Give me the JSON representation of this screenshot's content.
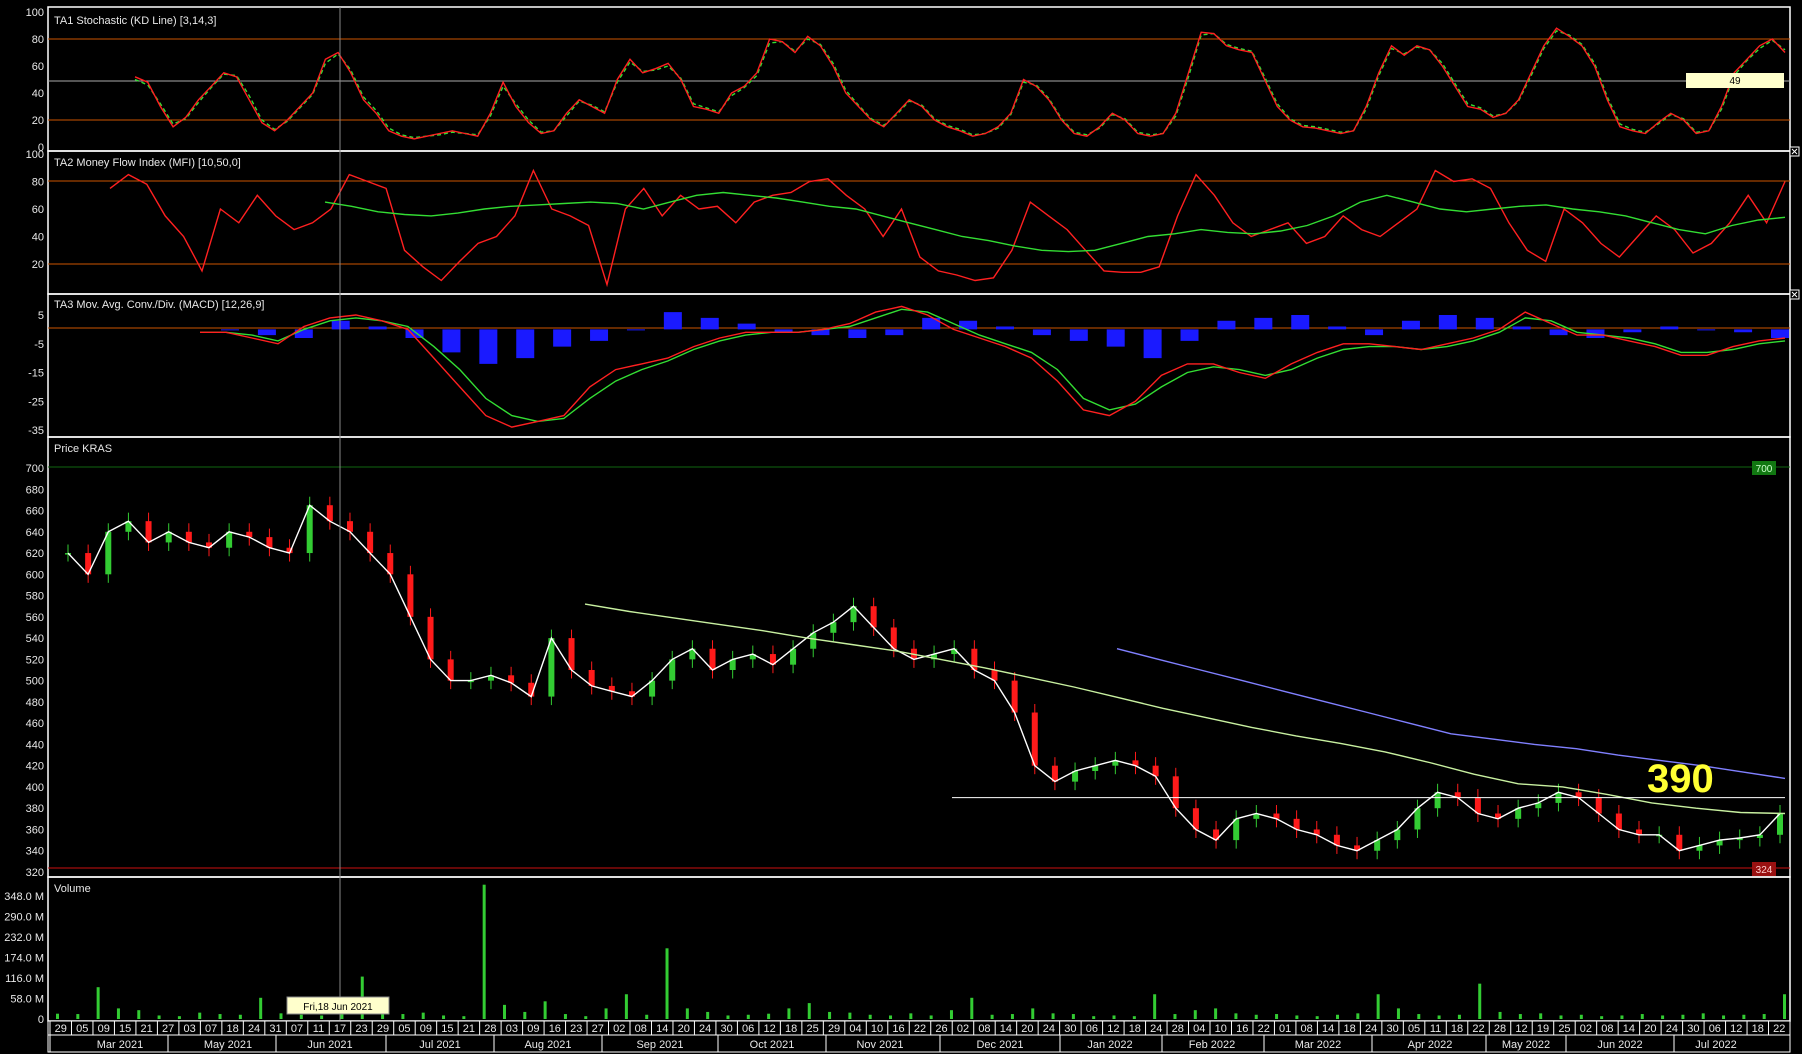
{
  "panels": {
    "stoch": {
      "title": "TA1 Stochastic (KD Line) [3,14,3]",
      "ticks": [
        "100",
        "80",
        "60",
        "40",
        "20",
        "0"
      ],
      "value_tag": "49"
    },
    "mfi": {
      "title": "TA2 Money Flow Index (MFI) [10,50,0]",
      "ticks": [
        "100",
        "80",
        "60",
        "40",
        "20"
      ]
    },
    "macd": {
      "title": "TA3 Mov. Avg. Conv./Div. (MACD) [12,26,9]",
      "ticks": [
        "5",
        "-5",
        "-15",
        "-25",
        "-35"
      ]
    },
    "price": {
      "title": "Price KRAS",
      "ticks": [
        "700",
        "680",
        "660",
        "640",
        "620",
        "600",
        "580",
        "560",
        "540",
        "520",
        "500",
        "480",
        "460",
        "440",
        "420",
        "400",
        "380",
        "360",
        "340",
        "320"
      ],
      "high_tag": "700",
      "low_tag": "324",
      "annotation": "390"
    },
    "volume": {
      "title": "Volume",
      "ticks": [
        "348.0 M",
        "290.0 M",
        "232.0 M",
        "174.0 M",
        "116.0 M",
        "58.0 M",
        "0"
      ],
      "cursor_tag": "Fri,18 Jun 2021"
    }
  },
  "date_axis": {
    "days": [
      "29",
      "05",
      "09",
      "15",
      "21",
      "27",
      "03",
      "07",
      "18",
      "24",
      "31",
      "07",
      "11",
      "17",
      "23",
      "29",
      "05",
      "09",
      "15",
      "21",
      "28",
      "03",
      "09",
      "16",
      "23",
      "27",
      "02",
      "08",
      "14",
      "20",
      "24",
      "30",
      "06",
      "12",
      "18",
      "25",
      "29",
      "04",
      "10",
      "16",
      "22",
      "26",
      "02",
      "08",
      "14",
      "20",
      "24",
      "30",
      "06",
      "12",
      "18",
      "24",
      "28",
      "04",
      "10",
      "16",
      "22",
      "01",
      "08",
      "14",
      "18",
      "24",
      "30",
      "05",
      "11",
      "18",
      "22",
      "28",
      "12",
      "19",
      "25",
      "02",
      "08",
      "14",
      "20",
      "24",
      "30",
      "06",
      "12",
      "18",
      "22"
    ],
    "months": [
      "Mar 2021",
      "May 2021",
      "Jun 2021",
      "Jul 2021",
      "Aug 2021",
      "Sep 2021",
      "Oct 2021",
      "Nov 2021",
      "Dec 2021",
      "Jan 2022",
      "Feb 2022",
      "Mar 2022",
      "Apr 2022",
      "May 2022",
      "Jun 2022",
      "Jul 2022"
    ]
  },
  "colors": {
    "up": "#33cc33",
    "down": "#ff1a1a",
    "k_line": "#ff2020",
    "d_line": "#33dd33",
    "mfi_line": "#ff2020",
    "mfi_ma": "#33dd33",
    "hist": "#1a1aff",
    "ma_short": "#ffffff",
    "ma_mid": "#c8f0a0",
    "ma_long": "#8080ff",
    "level": "#cc5500"
  },
  "chart_data": [
    {
      "type": "line",
      "title": "TA1 Stochastic (KD Line) [3,14,3]",
      "ylim": [
        0,
        100
      ],
      "series": [
        {
          "values": [
            52,
            48,
            30,
            15,
            22,
            35,
            45,
            55,
            52,
            35,
            18,
            12,
            20,
            30,
            40,
            65,
            70,
            55,
            35,
            25,
            12,
            8,
            6,
            8,
            10,
            12,
            10,
            8,
            25,
            48,
            30,
            18,
            10,
            12,
            25,
            35,
            30,
            25,
            50,
            65,
            55,
            58,
            62,
            50,
            30,
            28,
            25,
            40,
            45,
            55,
            80,
            78,
            70,
            82,
            75,
            60,
            40,
            30,
            20,
            15,
            25,
            35,
            30,
            20,
            15,
            12,
            8,
            10,
            15,
            25,
            50,
            45,
            35,
            20,
            10,
            8,
            15,
            25,
            20,
            10,
            8,
            10,
            25,
            55,
            85,
            84,
            75,
            72,
            70,
            50,
            30,
            20,
            15,
            14,
            12,
            10,
            12,
            30,
            55,
            75,
            68,
            75,
            72,
            60,
            45,
            30,
            28,
            22,
            25,
            35,
            55,
            75,
            88,
            82,
            75,
            60,
            35,
            15,
            12,
            10,
            18,
            25,
            20,
            10,
            12,
            30,
            55,
            65,
            75,
            80,
            70
          ]
        },
        {
          "values": [
            50,
            46,
            32,
            17,
            21,
            33,
            44,
            54,
            53,
            38,
            20,
            13,
            19,
            29,
            39,
            62,
            69,
            57,
            37,
            27,
            14,
            9,
            7,
            8,
            9,
            11,
            10,
            9,
            23,
            45,
            32,
            20,
            11,
            12,
            23,
            34,
            31,
            26,
            48,
            63,
            56,
            57,
            60,
            51,
            32,
            29,
            26,
            38,
            44,
            53,
            77,
            78,
            71,
            80,
            76,
            62,
            42,
            31,
            21,
            16,
            24,
            34,
            31,
            21,
            16,
            13,
            9,
            10,
            14,
            24,
            48,
            46,
            36,
            21,
            11,
            9,
            14,
            24,
            21,
            11,
            9,
            10,
            23,
            52,
            83,
            84,
            76,
            73,
            71,
            52,
            32,
            21,
            16,
            15,
            13,
            11,
            12,
            28,
            53,
            73,
            69,
            74,
            72,
            62,
            47,
            32,
            29,
            23,
            25,
            34,
            53,
            73,
            86,
            83,
            76,
            62,
            37,
            17,
            13,
            11,
            17,
            24,
            21,
            11,
            12,
            28,
            53,
            64,
            73,
            79,
            72
          ]
        }
      ]
    },
    {
      "type": "line",
      "title": "TA2 Money Flow Index (MFI) [10,50,0]",
      "ylim": [
        0,
        100
      ],
      "series": [
        {
          "values": [
            75,
            85,
            78,
            55,
            40,
            15,
            60,
            50,
            70,
            55,
            45,
            50,
            60,
            85,
            80,
            75,
            30,
            18,
            8,
            22,
            35,
            40,
            55,
            88,
            60,
            55,
            48,
            5,
            60,
            75,
            55,
            70,
            60,
            62,
            50,
            65,
            70,
            72,
            80,
            82,
            70,
            60,
            40,
            60,
            25,
            15,
            12,
            8,
            10,
            30,
            65,
            55,
            45,
            30,
            15,
            14,
            14,
            18,
            55,
            85,
            70,
            50,
            40,
            45,
            50,
            35,
            40,
            55,
            45,
            40,
            50,
            60,
            88,
            80,
            82,
            75,
            50,
            30,
            22,
            60,
            50,
            35,
            25,
            40,
            55,
            45,
            28,
            35,
            50,
            70,
            50,
            80
          ]
        },
        {
          "values": [
            65,
            62,
            58,
            56,
            55,
            57,
            60,
            62,
            63,
            64,
            65,
            64,
            60,
            65,
            70,
            72,
            70,
            68,
            65,
            62,
            60,
            55,
            50,
            45,
            40,
            37,
            33,
            30,
            29,
            30,
            35,
            40,
            42,
            45,
            43,
            42,
            44,
            48,
            55,
            65,
            70,
            65,
            60,
            58,
            60,
            62,
            63,
            60,
            58,
            55,
            50,
            45,
            42,
            48,
            52,
            54
          ]
        }
      ]
    },
    {
      "type": "bar",
      "title": "TA3 Mov. Avg. Conv./Div. (MACD) [12,26,9]",
      "ylim": [
        -35,
        8
      ],
      "series": [
        {
          "values": [
            -1,
            -1,
            -3,
            -5,
            1,
            4,
            5,
            3,
            0,
            -10,
            -20,
            -30,
            -34,
            -32,
            -30,
            -20,
            -14,
            -12,
            -10,
            -6,
            -3,
            -1,
            -1,
            -1,
            0,
            2,
            6,
            8,
            5,
            0,
            -3,
            -6,
            -10,
            -18,
            -28,
            -30,
            -25,
            -16,
            -12,
            -12,
            -15,
            -17,
            -12,
            -8,
            -5,
            -5,
            -6,
            -7,
            -5,
            -3,
            0,
            6,
            2,
            -2,
            -2,
            -4,
            -6,
            -9,
            -9,
            -6,
            -4,
            -3
          ]
        },
        {
          "values": [
            -1,
            -1,
            -2,
            -4,
            0,
            3,
            4,
            3,
            1,
            -6,
            -14,
            -24,
            -30,
            -32,
            -31,
            -24,
            -18,
            -14,
            -11,
            -7,
            -4,
            -2,
            -1,
            -1,
            0,
            1,
            4,
            7,
            6,
            2,
            -2,
            -5,
            -8,
            -14,
            -24,
            -28,
            -26,
            -20,
            -15,
            -13,
            -14,
            -16,
            -14,
            -10,
            -7,
            -6,
            -6,
            -7,
            -6,
            -4,
            -1,
            4,
            3,
            -1,
            -2,
            -3,
            -5,
            -8,
            -8,
            -7,
            -5,
            -4
          ]
        },
        {
          "values": [
            0,
            -2,
            -3,
            3,
            1,
            -3,
            -8,
            -12,
            -10,
            -6,
            -4,
            0,
            6,
            4,
            2,
            -1,
            -2,
            -3,
            -2,
            4,
            3,
            1,
            -2,
            -4,
            -6,
            -10,
            -4,
            3,
            4,
            5,
            1,
            -2,
            3,
            5,
            4,
            1,
            -2,
            -3,
            -1,
            1,
            0,
            -1,
            -3
          ]
        }
      ]
    },
    {
      "type": "line",
      "title": "Price KRAS",
      "ylim": [
        320,
        705
      ],
      "yticks": [
        700,
        680,
        660,
        640,
        620,
        600,
        580,
        560,
        540,
        520,
        500,
        480,
        460,
        440,
        420,
        400,
        380,
        360,
        340,
        320
      ],
      "series": [
        {
          "values": [
            620,
            600,
            640,
            650,
            630,
            640,
            630,
            625,
            640,
            635,
            625,
            620,
            665,
            650,
            640,
            620,
            600,
            560,
            520,
            500,
            500,
            505,
            498,
            485,
            540,
            510,
            495,
            490,
            485,
            500,
            520,
            530,
            510,
            520,
            525,
            515,
            530,
            545,
            555,
            570,
            550,
            530,
            520,
            525,
            530,
            510,
            500,
            470,
            420,
            405,
            415,
            420,
            425,
            420,
            410,
            380,
            360,
            350,
            370,
            375,
            370,
            360,
            355,
            345,
            340,
            350,
            360,
            380,
            395,
            390,
            375,
            370,
            380,
            385,
            395,
            390,
            375,
            360,
            355,
            355,
            340,
            345,
            350,
            352,
            355,
            375
          ]
        },
        {
          "values": [
            572,
            565,
            559,
            553,
            547,
            540,
            534,
            528,
            520,
            512,
            503,
            494,
            484,
            474,
            465,
            456,
            448,
            441,
            433,
            423,
            412,
            403,
            400,
            393,
            385,
            380,
            376,
            375
          ]
        },
        {
          "values": [
            530,
            520,
            510,
            500,
            490,
            480,
            470,
            460,
            450,
            445,
            440,
            436,
            430,
            425,
            420,
            414,
            408
          ]
        },
        {
          "name": "Horizontal line",
          "values": [
            390
          ]
        }
      ]
    },
    {
      "type": "bar",
      "title": "Volume",
      "ylim": [
        0,
        348
      ],
      "series": [
        {
          "values": [
            15,
            14,
            90,
            30,
            25,
            10,
            8,
            18,
            14,
            12,
            60,
            16,
            12,
            10,
            35,
            120,
            22,
            14,
            18,
            10,
            8,
            380,
            40,
            20,
            50,
            14,
            8,
            30,
            70,
            12,
            200,
            30,
            20,
            10,
            12,
            15,
            30,
            45,
            20,
            18,
            12,
            10,
            16,
            10,
            25,
            60,
            12,
            14,
            30,
            16,
            14,
            8,
            10,
            8,
            70,
            14,
            25,
            30,
            16,
            12,
            14,
            10,
            8,
            12,
            16,
            70,
            30,
            14,
            10,
            12,
            100,
            20,
            14,
            16,
            10,
            12,
            8,
            10,
            14,
            10,
            12,
            16,
            10,
            12,
            14,
            70
          ]
        }
      ]
    }
  ]
}
